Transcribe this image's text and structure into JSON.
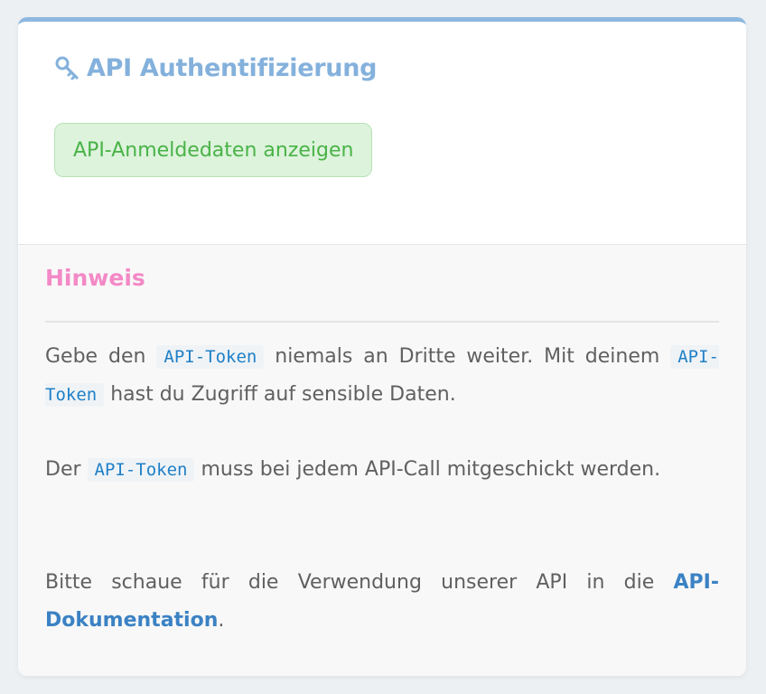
{
  "card": {
    "title": "API Authentifizierung",
    "title_icon": "key-icon",
    "show_credentials_label": "API-Anmeldedaten anzeigen"
  },
  "hint": {
    "title": "Hinweis",
    "p1_a": "Gebe den ",
    "p1_code1": "API-Token",
    "p1_b": " niemals an Dritte weiter. Mit deinem ",
    "p1_code2": "API-Token",
    "p1_c": " hast du Zugriff auf sensible Daten.",
    "p2_a": "Der ",
    "p2_code": "API-Token",
    "p2_b": " muss bei jedem API-Call mitgeschickt werden.",
    "p3_a": "Bitte schaue für die Verwendung unserer API in die ",
    "p3_link": "API-Dokumentation",
    "p3_b": "."
  },
  "colors": {
    "title": "#84b1dc",
    "card_top_border": "#8db8df",
    "button_bg": "#ddf3dc",
    "button_text": "#49b347",
    "hint_title": "#f389c6",
    "code_text": "#1f80c8",
    "link": "#3b82c4"
  }
}
